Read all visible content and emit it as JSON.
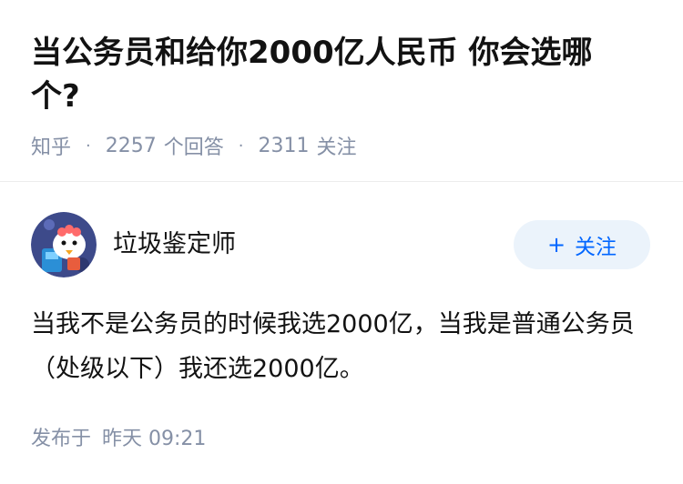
{
  "question": {
    "title": "当公务员和给你2000亿人民币 你会选哪个?",
    "source": "知乎",
    "answers_count": "2257",
    "answers_label": "个回答",
    "followers_count": "2311",
    "followers_label": "关注"
  },
  "answer": {
    "author_name": "垃圾鉴定师",
    "avatar_icon": "avatar-cartoon-icon",
    "follow_label": "关注",
    "follow_icon": "plus-icon",
    "text": "当我不是公务员的时候我选2000亿，当我是普通公务员（处级以下）我还选2000亿。",
    "posted_label": "发布于",
    "posted_time": "昨天 09:21"
  },
  "colors": {
    "accent": "#0066ff",
    "follow_bg": "#ebf3fb",
    "meta_gray": "#8590a6",
    "text": "#121212"
  }
}
